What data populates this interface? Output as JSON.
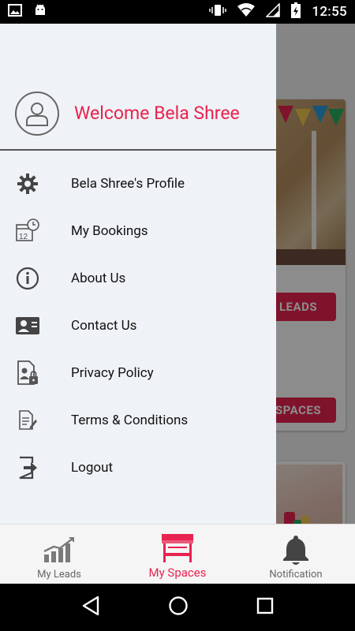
{
  "status_bar": {
    "time": "12:55"
  },
  "background": {
    "leads_button_label": "LEADS",
    "spaces_button_label": "SPACES"
  },
  "drawer": {
    "welcome": "Welcome Bela Shree",
    "menu": [
      {
        "label": "Bela Shree's Profile",
        "icon": "gear-icon"
      },
      {
        "label": "My Bookings",
        "icon": "calendar-clock-icon"
      },
      {
        "label": "About Us",
        "icon": "info-icon"
      },
      {
        "label": "Contact Us",
        "icon": "contact-card-icon"
      },
      {
        "label": "Privacy Policy",
        "icon": "privacy-document-icon"
      },
      {
        "label": "Terms & Conditions",
        "icon": "terms-document-icon"
      },
      {
        "label": "Logout",
        "icon": "logout-icon"
      }
    ]
  },
  "bottom_nav": {
    "items": [
      {
        "label": "My Leads",
        "icon": "growth-chart-icon",
        "active": false
      },
      {
        "label": "My Spaces",
        "icon": "stall-icon",
        "active": true
      },
      {
        "label": "Notification",
        "icon": "bell-icon",
        "active": false
      }
    ]
  },
  "colors": {
    "accent": "#e8234f",
    "drawer_bg": "#eff2f6"
  }
}
